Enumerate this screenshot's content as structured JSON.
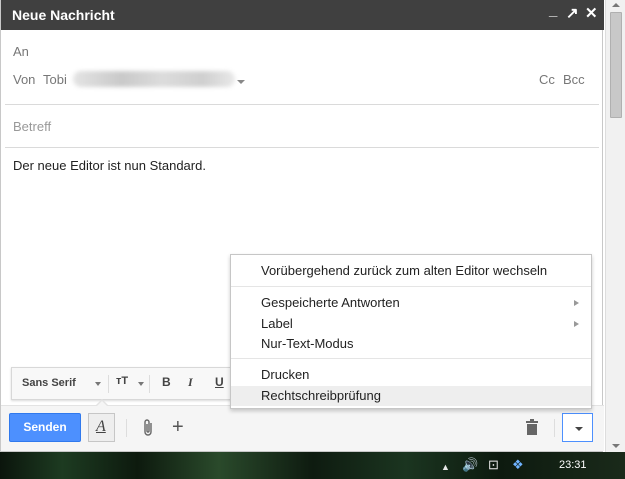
{
  "window": {
    "title": "Neue Nachricht",
    "controls": {
      "minimize": "_",
      "popout": "↗",
      "close": "✕"
    }
  },
  "header": {
    "to_label": "An",
    "from_label": "Von",
    "from_name": "Tobi",
    "cc_label": "Cc",
    "bcc_label": "Bcc"
  },
  "subject": {
    "placeholder": "Betreff"
  },
  "body": {
    "text": "Der neue Editor ist nun Standard."
  },
  "format_toolbar": {
    "font_family": "Sans Serif",
    "size_label": "тT",
    "bold": "B",
    "italic": "I",
    "underline": "U"
  },
  "bottom_bar": {
    "send_label": "Senden",
    "format_glyph": "A",
    "attach_icon": "paperclip-icon",
    "more_options_icon": "plus-icon",
    "plus_glyph": "+",
    "discard_icon": "trash-icon",
    "menu_toggle_icon": "chevron-down-icon"
  },
  "menu": {
    "items": [
      {
        "label": "Vorübergehend zurück zum alten Editor wechseln",
        "submenu": false,
        "highlighted": false
      },
      {
        "label": "Gespeicherte Antworten",
        "submenu": true,
        "highlighted": false
      },
      {
        "label": "Label",
        "submenu": true,
        "highlighted": false
      },
      {
        "label": "Nur-Text-Modus",
        "submenu": false,
        "highlighted": false
      },
      {
        "label": "Drucken",
        "submenu": false,
        "highlighted": false
      },
      {
        "label": "Rechtschreibprüfung",
        "submenu": false,
        "highlighted": true
      }
    ]
  },
  "taskbar": {
    "tray_icons": [
      "up-arrow-icon",
      "volume-icon",
      "network-icon",
      "dropbox-icon"
    ],
    "tray_glyphs": {
      "up": "▲",
      "volume": "🔊",
      "network": "⊡",
      "dropbox": "❖"
    },
    "clock": "23:31"
  },
  "colors": {
    "titlebar": "#404040",
    "send_button": "#4d90fe",
    "menu_highlight": "#eeeeee"
  }
}
